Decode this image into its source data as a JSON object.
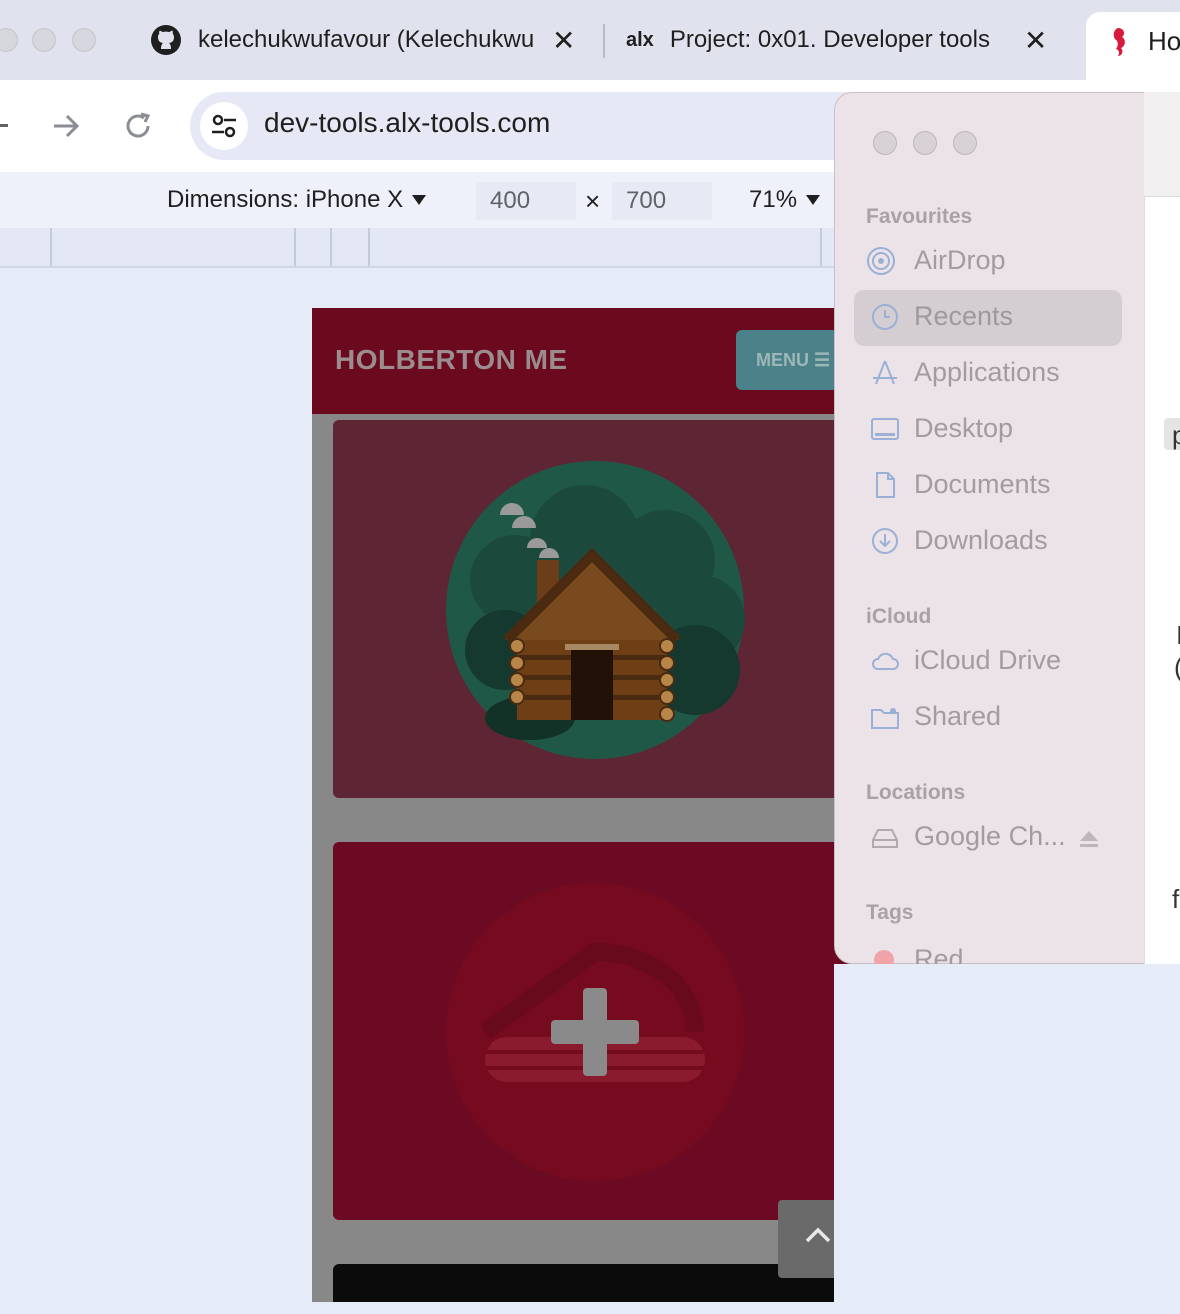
{
  "tabs": [
    {
      "title": "kelechukwufavour (Kelechukwu",
      "close": "✕",
      "icon": "github-icon"
    },
    {
      "title": "Project: 0x01. Developer tools",
      "close": "✕",
      "icon": "alx-icon",
      "favicon_text": "alx"
    },
    {
      "title": "Ho",
      "icon": "seahorse-icon"
    }
  ],
  "toolbar": {
    "url": "dev-tools.alx-tools.com"
  },
  "devtools": {
    "dimensions_label": "Dimensions: iPhone X",
    "width": "400",
    "times": "×",
    "height": "700",
    "zoom": "71%"
  },
  "site": {
    "title": "HOLBERTON ME",
    "menu_label": "MENU ☰"
  },
  "finder": {
    "sections": {
      "favourites": "Favourites",
      "icloud": "iCloud",
      "locations": "Locations",
      "tags": "Tags"
    },
    "favourites": [
      "AirDrop",
      "Recents",
      "Applications",
      "Desktop",
      "Documents",
      "Downloads"
    ],
    "icloud": [
      "iCloud Drive",
      "Shared"
    ],
    "locations": [
      "Google Ch..."
    ],
    "tags": [
      "Red"
    ],
    "selected": "Recents",
    "right_fragments": [
      "p",
      "I",
      "(",
      "f"
    ]
  },
  "colors": {
    "site_header": "#6b0a1f",
    "menu_button": "#4b8188",
    "card_one": "#5e2534",
    "card_two": "#6b0a22",
    "tag_red": "#f0a3a8"
  }
}
